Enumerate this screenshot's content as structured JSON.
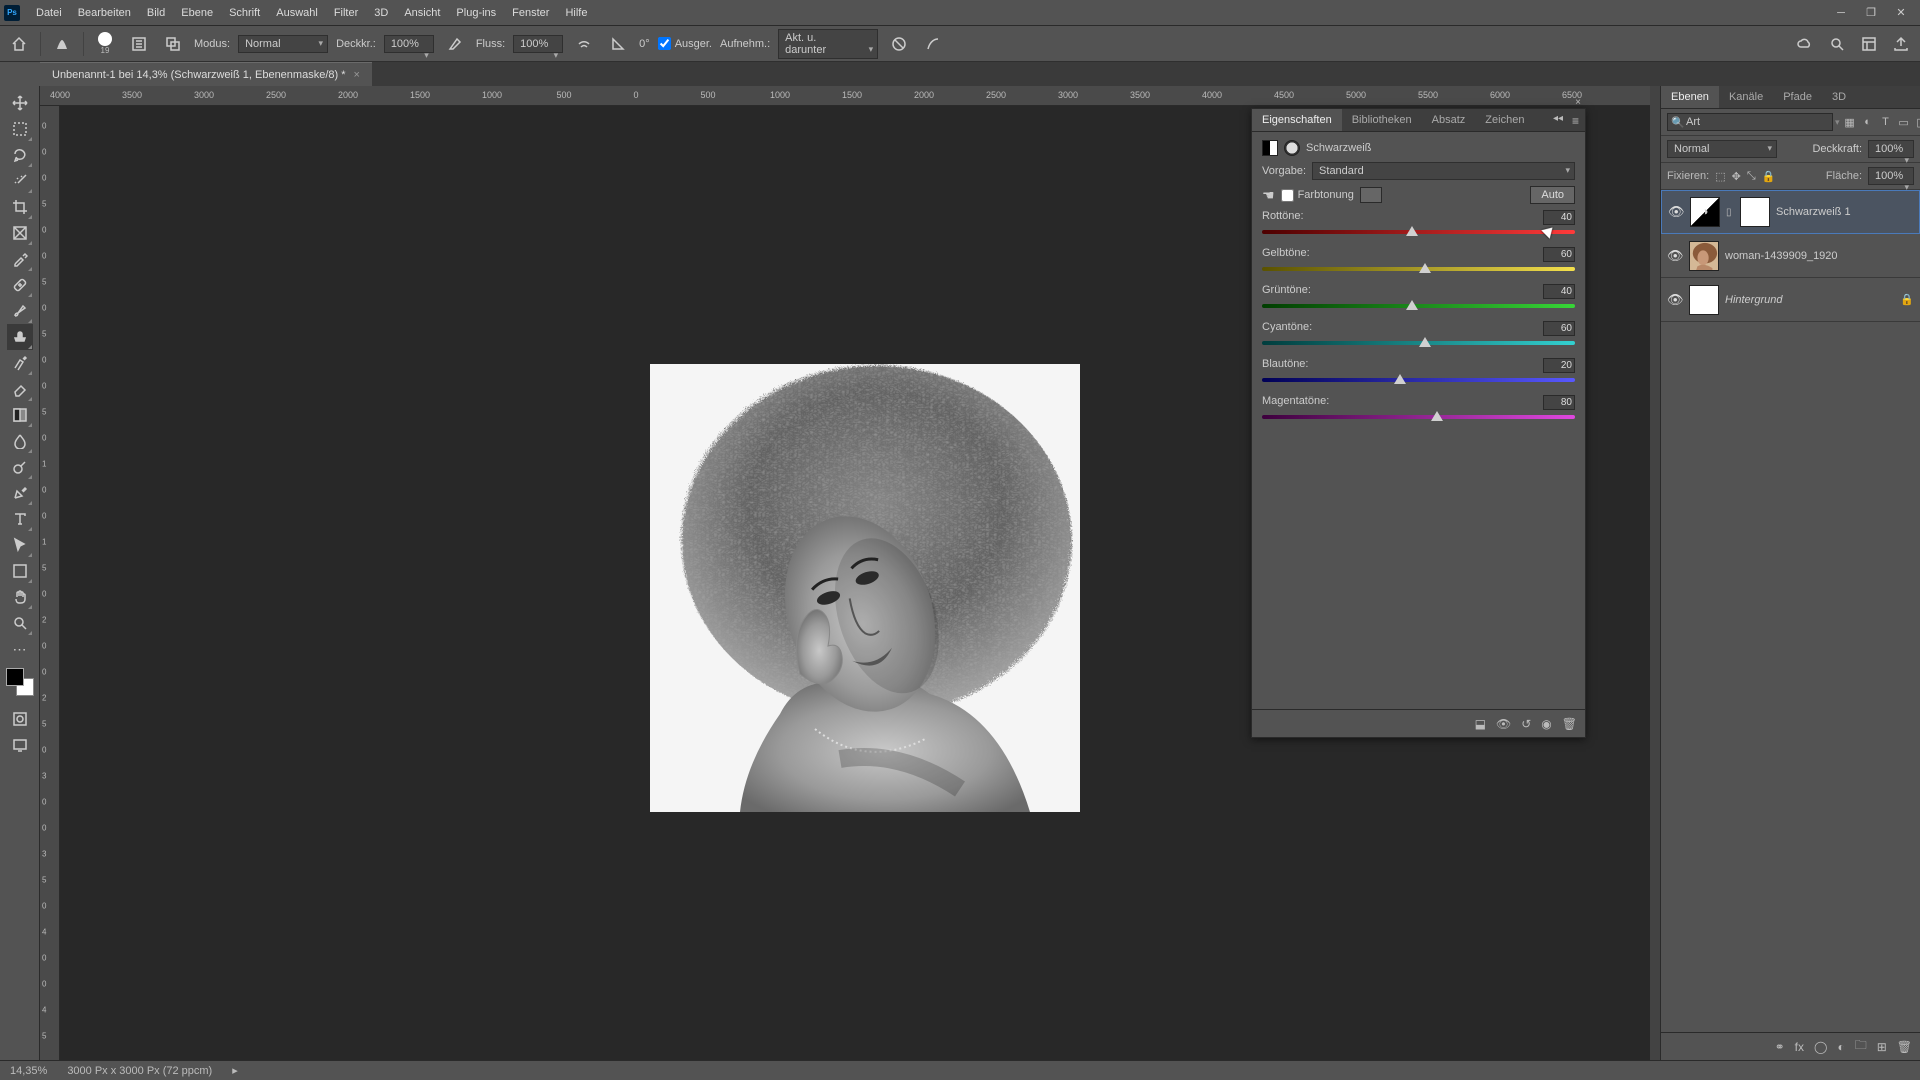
{
  "menu": [
    "Datei",
    "Bearbeiten",
    "Bild",
    "Ebene",
    "Schrift",
    "Auswahl",
    "Filter",
    "3D",
    "Ansicht",
    "Plug-ins",
    "Fenster",
    "Hilfe"
  ],
  "doc_tab": "Unbenannt-1 bei 14,3% (Schwarzweiß 1, Ebenenmaske/8) *",
  "options": {
    "brush_size": "19",
    "mode_lbl": "Modus:",
    "mode_val": "Normal",
    "opacity_lbl": "Deckkr.:",
    "opacity_val": "100%",
    "flow_lbl": "Fluss:",
    "flow_val": "100%",
    "smooth_val": "0°",
    "aligned_lbl": "Ausger.",
    "sample_lbl": "Aufnehm.:",
    "sample_val": "Akt. u. darunter"
  },
  "ruler_h": [
    "4000",
    "3500",
    "3000",
    "2500",
    "2000",
    "1500",
    "1000",
    "500",
    "0",
    "500",
    "1000",
    "1500",
    "2000",
    "2500",
    "3000",
    "3500",
    "4000",
    "4500",
    "5000",
    "5500",
    "6000",
    "6500"
  ],
  "ruler_v_labels": [
    "0",
    "0",
    "0",
    "5",
    "0",
    "0",
    "5",
    "0",
    "5",
    "0",
    "0",
    "5",
    "0",
    "1",
    "0",
    "0",
    "1",
    "5",
    "0",
    "2",
    "0",
    "0",
    "2",
    "5",
    "0",
    "3",
    "0",
    "0",
    "3",
    "5",
    "0",
    "4",
    "0",
    "0",
    "4",
    "5"
  ],
  "props": {
    "tabs": [
      "Eigenschaften",
      "Bibliotheken",
      "Absatz",
      "Zeichen"
    ],
    "title": "Schwarzweiß",
    "preset_lbl": "Vorgabe:",
    "preset_val": "Standard",
    "tint_lbl": "Farbtonung",
    "auto_lbl": "Auto",
    "sliders": [
      {
        "label": "Rottöne:",
        "value": 40,
        "class": "grad-red"
      },
      {
        "label": "Gelbtöne:",
        "value": 60,
        "class": "grad-yel"
      },
      {
        "label": "Grüntöne:",
        "value": 40,
        "class": "grad-grn"
      },
      {
        "label": "Cyantöne:",
        "value": 60,
        "class": "grad-cyn"
      },
      {
        "label": "Blautöne:",
        "value": 20,
        "class": "grad-blu"
      },
      {
        "label": "Magentatöne:",
        "value": 80,
        "class": "grad-mag"
      }
    ]
  },
  "layers_panel": {
    "tabs": [
      "Ebenen",
      "Kanäle",
      "Pfade",
      "3D"
    ],
    "search_val": "Art",
    "blend_val": "Normal",
    "opacity_lbl": "Deckkraft:",
    "opacity_val": "100%",
    "lock_lbl": "Fixieren:",
    "fill_lbl": "Fläche:",
    "fill_val": "100%",
    "layers": [
      {
        "name": "Schwarzweiß 1",
        "type": "adj",
        "selected": true,
        "italic": false
      },
      {
        "name": "woman-1439909_1920",
        "type": "img",
        "selected": false,
        "italic": false
      },
      {
        "name": "Hintergrund",
        "type": "bg",
        "selected": false,
        "italic": true,
        "locked": true
      }
    ]
  },
  "status": {
    "zoom": "14,35%",
    "dims": "3000 Px x 3000 Px (72 ppcm)"
  }
}
